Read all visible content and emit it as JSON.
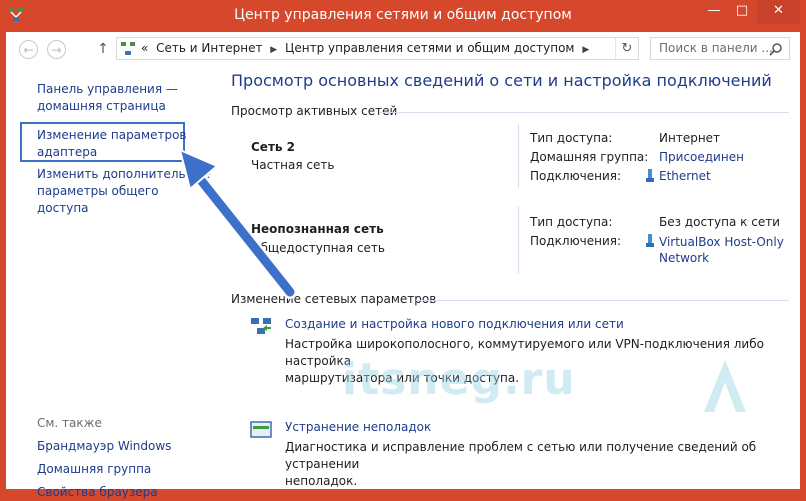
{
  "window": {
    "title": "Центр управления сетями и общим доступом",
    "controls": {
      "minimize": "—",
      "maximize": "□",
      "close": "✕"
    }
  },
  "navbar": {
    "back": "←",
    "forward": "→",
    "up": "↑",
    "breadcrumb_lead": "«",
    "crumbs": [
      "Сеть и Интернет",
      "Центр управления сетями и общим доступом"
    ],
    "crumb_sep": "▶",
    "refresh": "↻",
    "search_placeholder": "Поиск в панели ..."
  },
  "left": {
    "home_link": [
      "Панель управления —",
      "домашняя страница"
    ],
    "adapter_link": [
      "Изменение параметров",
      "адаптера"
    ],
    "sharing_link": [
      "Изменить дополнительные",
      "параметры общего доступа"
    ],
    "see_also": "См. также",
    "see_also_links": [
      "Брандмауэр Windows",
      "Домашняя группа",
      "Свойства браузера"
    ]
  },
  "main": {
    "heading": "Просмотр основных сведений о сети и настройка подключений",
    "active_title": "Просмотр активных сетей",
    "networks": [
      {
        "name": "Сеть  2",
        "type": "Частная сеть",
        "access_label": "Тип доступа:",
        "access_value": "Интернет",
        "homegroup_label": "Домашняя группа:",
        "homegroup_value": "Присоединен",
        "conn_label": "Подключения:",
        "conn_value": "Ethernet"
      },
      {
        "name": "Неопознанная сеть",
        "type": "Общедоступная сеть",
        "access_label": "Тип доступа:",
        "access_value": "Без доступа к сети",
        "conn_label": "Подключения:",
        "conn_value": [
          "VirtualBox Host-Only",
          "Network"
        ]
      }
    ],
    "change_title": "Изменение сетевых параметров",
    "tasks": [
      {
        "title": "Создание и настройка нового подключения или сети",
        "desc": [
          "Настройка широкополосного, коммутируемого или VPN-подключения либо настройка",
          "маршрутизатора или точки доступа."
        ]
      },
      {
        "title": "Устранение неполадок",
        "desc": [
          "Диагностика и исправление проблем с сетью или получение сведений об устранении",
          "неполадок."
        ]
      }
    ]
  },
  "watermark": "itsneg.ru",
  "colors": {
    "titlebar": "#d6482c",
    "link": "#1e3c8a",
    "highlight": "#3d70c8"
  }
}
